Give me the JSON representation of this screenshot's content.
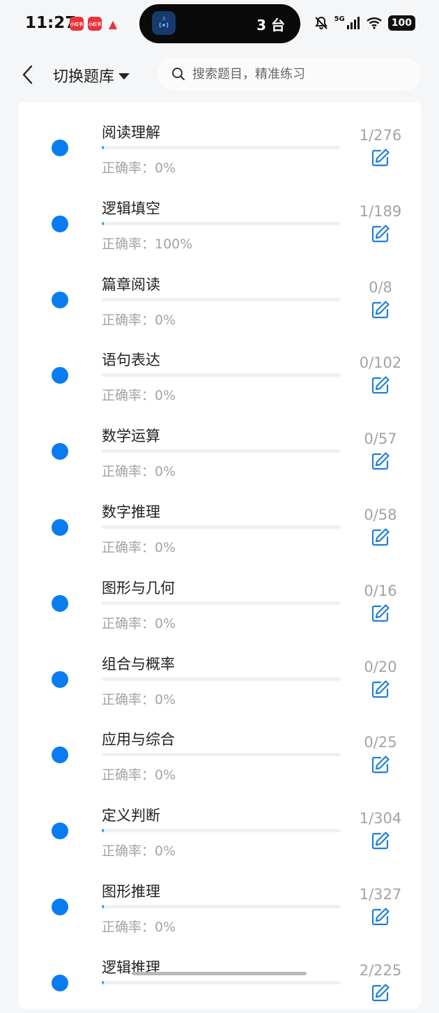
{
  "status": {
    "time": "11:27",
    "island_text": "3 台",
    "island_badge": "3",
    "network": "5G",
    "battery": "100",
    "app_badge_1": "小红书",
    "app_badge_2": "小红书"
  },
  "header": {
    "title": "切换题库",
    "search_placeholder": "搜索题目，精准练习"
  },
  "colors": {
    "accent": "#0a7cf2",
    "progress": "#2e9fe6"
  },
  "items": [
    {
      "name": "阅读理解",
      "accuracy": "正确率：0%",
      "count": "1/276",
      "done": 1,
      "total": 276
    },
    {
      "name": "逻辑填空",
      "accuracy": "正确率：100%",
      "count": "1/189",
      "done": 1,
      "total": 189
    },
    {
      "name": "篇章阅读",
      "accuracy": "正确率：0%",
      "count": "0/8",
      "done": 0,
      "total": 8
    },
    {
      "name": "语句表达",
      "accuracy": "正确率：0%",
      "count": "0/102",
      "done": 0,
      "total": 102
    },
    {
      "name": "数学运算",
      "accuracy": "正确率：0%",
      "count": "0/57",
      "done": 0,
      "total": 57
    },
    {
      "name": "数字推理",
      "accuracy": "正确率：0%",
      "count": "0/58",
      "done": 0,
      "total": 58
    },
    {
      "name": "图形与几何",
      "accuracy": "正确率：0%",
      "count": "0/16",
      "done": 0,
      "total": 16
    },
    {
      "name": "组合与概率",
      "accuracy": "正确率：0%",
      "count": "0/20",
      "done": 0,
      "total": 20
    },
    {
      "name": "应用与综合",
      "accuracy": "正确率：0%",
      "count": "0/25",
      "done": 0,
      "total": 25
    },
    {
      "name": "定义判断",
      "accuracy": "正确率：0%",
      "count": "1/304",
      "done": 1,
      "total": 304
    },
    {
      "name": "图形推理",
      "accuracy": "正确率：0%",
      "count": "1/327",
      "done": 1,
      "total": 327
    },
    {
      "name": "逻辑推理",
      "accuracy": "",
      "count": "2/225",
      "done": 2,
      "total": 225
    }
  ]
}
